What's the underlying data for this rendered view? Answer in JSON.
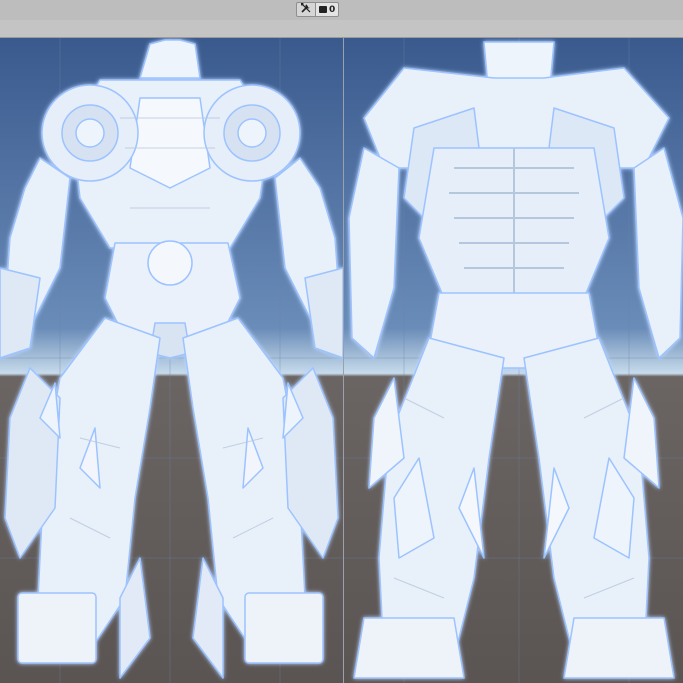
{
  "toolbar": {
    "tools_icon": "wrench-screwdriver-icon",
    "camera_icon": "camera-icon",
    "camera_label": "0"
  },
  "viewports": [
    {
      "name": "viewport-left",
      "model": "robot-front-view"
    },
    {
      "name": "viewport-right",
      "model": "robot-back-view"
    }
  ],
  "colors": {
    "sky_top": "#3d5f93",
    "sky_horizon": "#c7dbeb",
    "ground": "#5e5856",
    "mesh": "#e8f0fa",
    "mesh_shadow": "#b9c9dc",
    "mesh_edge": "#9cc3ff"
  }
}
